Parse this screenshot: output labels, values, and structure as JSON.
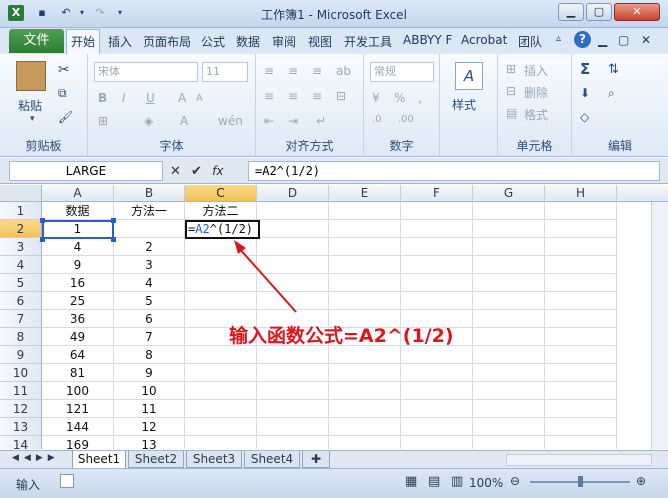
{
  "window": {
    "title": "工作簿1 - Microsoft Excel",
    "minimize_icon": "minimize-icon",
    "maximize_icon": "maximize-icon",
    "close_glyph": "✕"
  },
  "menu_tabs": [
    "文件",
    "开始",
    "插入",
    "页面布局",
    "公式",
    "数据",
    "审阅",
    "视图",
    "开发工具",
    "ABBYY F",
    "Acrobat",
    "团队"
  ],
  "ribbon": {
    "clipboard": {
      "paste": "粘贴",
      "label": "剪贴板"
    },
    "font": {
      "name": "宋体",
      "size": "11",
      "label": "字体"
    },
    "alignment": {
      "label": "对齐方式"
    },
    "number": {
      "format": "常规",
      "percent": "%",
      "comma": ",",
      "label": "数字"
    },
    "styles": {
      "label": "样式"
    },
    "cells": {
      "insert": "插入",
      "delete": "删除",
      "format": "格式",
      "label": "单元格"
    },
    "editing": {
      "sigma": "Σ",
      "label": "编辑"
    }
  },
  "formula_bar": {
    "name_box": "LARGE",
    "fx": "fx",
    "formula": "=A2^(1/2)"
  },
  "columns": [
    "A",
    "B",
    "C",
    "D",
    "E",
    "F",
    "G",
    "H"
  ],
  "rows": [
    {
      "num": "1",
      "a": "数据",
      "b": "方法一",
      "c": "方法二"
    },
    {
      "num": "2",
      "a": "1",
      "b": "",
      "c": "=A2^(1/2)"
    },
    {
      "num": "3",
      "a": "4",
      "b": "2",
      "c": ""
    },
    {
      "num": "4",
      "a": "9",
      "b": "3",
      "c": ""
    },
    {
      "num": "5",
      "a": "16",
      "b": "4",
      "c": ""
    },
    {
      "num": "6",
      "a": "25",
      "b": "5",
      "c": ""
    },
    {
      "num": "7",
      "a": "36",
      "b": "6",
      "c": ""
    },
    {
      "num": "8",
      "a": "49",
      "b": "7",
      "c": ""
    },
    {
      "num": "9",
      "a": "64",
      "b": "8",
      "c": ""
    },
    {
      "num": "10",
      "a": "81",
      "b": "9",
      "c": ""
    },
    {
      "num": "11",
      "a": "100",
      "b": "10",
      "c": ""
    },
    {
      "num": "12",
      "a": "121",
      "b": "11",
      "c": ""
    },
    {
      "num": "13",
      "a": "144",
      "b": "12",
      "c": ""
    },
    {
      "num": "14",
      "a": "169",
      "b": "13",
      "c": ""
    }
  ],
  "annotation": "输入函数公式=A2^(1/2)",
  "sheet_tabs": [
    "Sheet1",
    "Sheet2",
    "Sheet3",
    "Sheet4"
  ],
  "status": {
    "mode": "输入",
    "zoom": "100%"
  },
  "colors": {
    "accent_green": "#2c7f33",
    "annotation_red": "#e0151b",
    "reference_blue": "#2a5bd7"
  }
}
